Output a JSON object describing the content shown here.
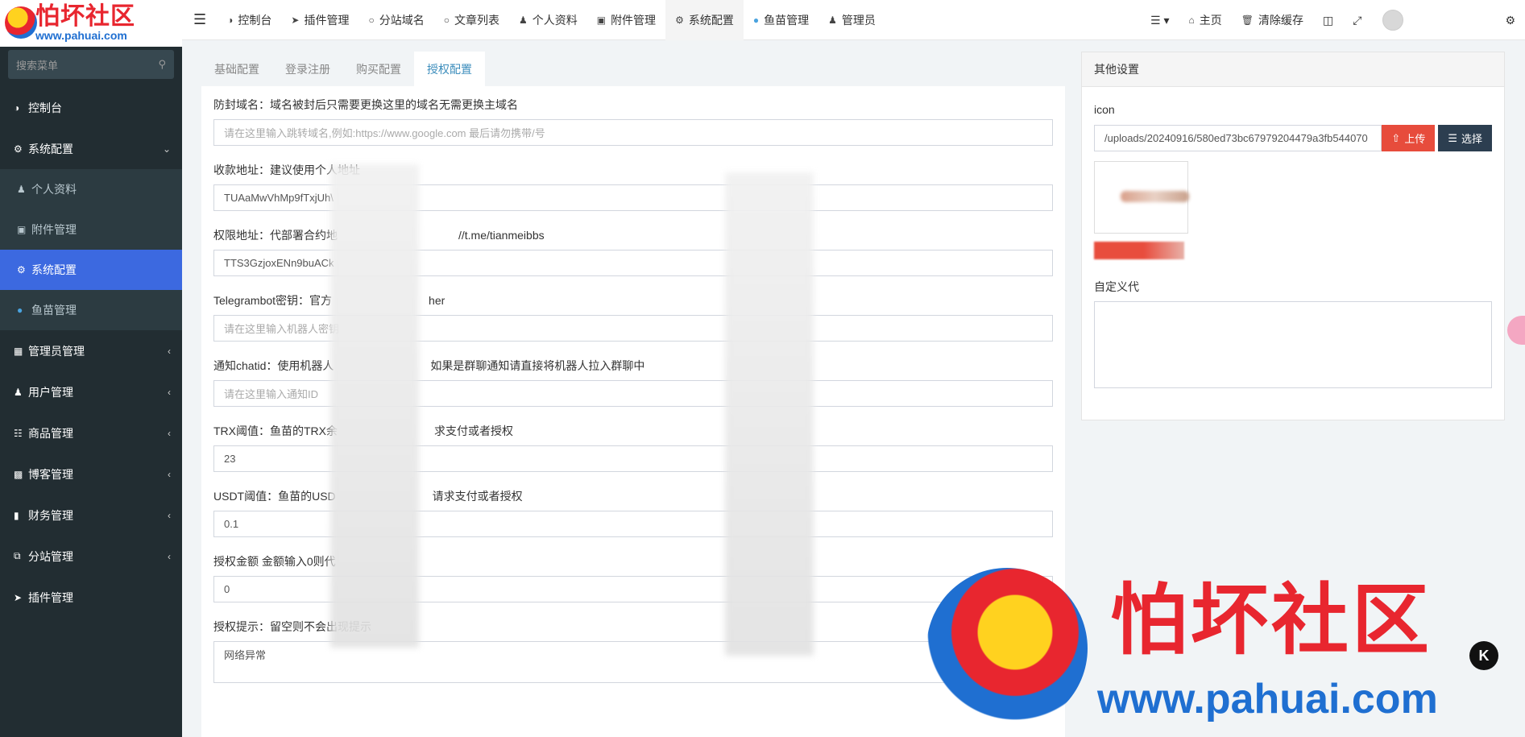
{
  "logo": {
    "title": "怕坏社区",
    "url": "www.pahuai.com"
  },
  "sidebar": {
    "search_placeholder": "搜索菜单",
    "items": [
      {
        "label": "控制台",
        "icon": "dashboard-icon"
      },
      {
        "label": "系统配置",
        "icon": "gears-icon",
        "expanded": true
      },
      {
        "label": "个人资料",
        "icon": "user-icon"
      },
      {
        "label": "附件管理",
        "icon": "image-icon"
      },
      {
        "label": "系统配置",
        "icon": "gear-icon",
        "active": true
      },
      {
        "label": "鱼苗管理",
        "icon": "fish-icon"
      },
      {
        "label": "管理员管理",
        "icon": "windows-icon"
      },
      {
        "label": "用户管理",
        "icon": "user-icon"
      },
      {
        "label": "商品管理",
        "icon": "cart-icon"
      },
      {
        "label": "博客管理",
        "icon": "book-icon"
      },
      {
        "label": "财务管理",
        "icon": "bookmark-icon"
      },
      {
        "label": "分站管理",
        "icon": "clone-icon"
      },
      {
        "label": "插件管理",
        "icon": "rocket-icon"
      }
    ]
  },
  "topbar": {
    "items": [
      {
        "label": "控制台",
        "icon": "dashboard-icon"
      },
      {
        "label": "插件管理",
        "icon": "rocket-icon"
      },
      {
        "label": "分站域名",
        "icon": "circle-icon"
      },
      {
        "label": "文章列表",
        "icon": "circle-icon"
      },
      {
        "label": "个人资料",
        "icon": "user-icon"
      },
      {
        "label": "附件管理",
        "icon": "image-icon"
      },
      {
        "label": "系统配置",
        "icon": "gear-icon",
        "active": true
      },
      {
        "label": "鱼苗管理",
        "icon": "fish-icon"
      },
      {
        "label": "管理员",
        "icon": "user-icon"
      }
    ],
    "right": {
      "home": "主页",
      "clear_cache": "清除缓存"
    }
  },
  "tabs": [
    "基础配置",
    "登录注册",
    "购买配置",
    "授权配置"
  ],
  "active_tab": "授权配置",
  "form": [
    {
      "label": "防封域名：域名被封后只需要更换这里的域名无需更换主域名",
      "value": "",
      "placeholder": "请在这里输入跳转域名,例如:https://www.google.com 最后请勿携带/号"
    },
    {
      "label": "收款地址：建议使用个人地址",
      "value": "TUAaMwVhMp9fTxjUh\\",
      "placeholder": ""
    },
    {
      "label": "权限地址：代部署合约地",
      "label_tail": "//t.me/tianmeibbs",
      "value": "TTS3GzjoxENn9buACk",
      "placeholder": ""
    },
    {
      "label": "Telegrambot密钥：官方",
      "label_tail": "her",
      "value": "",
      "placeholder": "请在这里输入机器人密钥"
    },
    {
      "label": "通知chatid：使用机器人",
      "label_tail": "如果是群聊通知请直接将机器人拉入群聊中",
      "value": "",
      "placeholder": "请在这里输入通知ID"
    },
    {
      "label": "TRX阈值：鱼苗的TRX余",
      "label_tail": "求支付或者授权",
      "value": "23",
      "placeholder": ""
    },
    {
      "label": "USDT阈值：鱼苗的USD",
      "label_tail": "请求支付或者授权",
      "value": "0.1",
      "placeholder": ""
    },
    {
      "label": "授权金额 金额输入0则代",
      "label_tail": "",
      "value": "0",
      "placeholder": ""
    }
  ],
  "hint": {
    "label": "授权提示：留空则不会出现提示",
    "value": "网络异常"
  },
  "side_panel": {
    "title": "其他设置",
    "icon_label": "icon",
    "icon_path": "/uploads/20240916/580ed73bc67979204479a3fb544070",
    "upload_label": "上传",
    "select_label": "选择",
    "custom_label": "自定义代"
  },
  "watermark": {
    "title": "怕坏社区",
    "url": "www.pahuai.com",
    "badge": "K"
  },
  "colors": {
    "sidebar_bg": "#222d32",
    "active_blue": "#3c69e0",
    "upload_red": "#e74c3c",
    "select_dark": "#2c3e50",
    "tab_active": "#3c8dbc"
  }
}
